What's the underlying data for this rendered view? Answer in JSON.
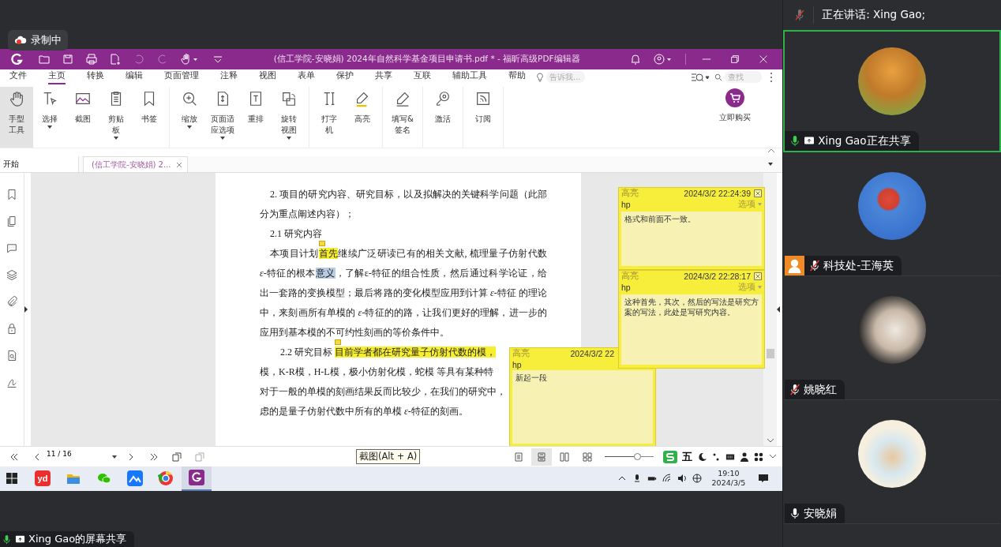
{
  "recording_badge": {
    "label": "录制中"
  },
  "editor": {
    "title": "(信工学院-安晓娟) 2024年自然科学基金项目申请书.pdf * - 福昕高级PDF编辑器",
    "menu_tabs": [
      {
        "label": "文件",
        "selected": false
      },
      {
        "label": "主页",
        "selected": true
      },
      {
        "label": "转换",
        "selected": false
      },
      {
        "label": "编辑",
        "selected": false
      },
      {
        "label": "页面管理",
        "selected": false
      },
      {
        "label": "注释",
        "selected": false
      },
      {
        "label": "视图",
        "selected": false
      },
      {
        "label": "表单",
        "selected": false
      },
      {
        "label": "保护",
        "selected": false
      },
      {
        "label": "共享",
        "selected": false
      },
      {
        "label": "互联",
        "selected": false
      },
      {
        "label": "辅助工具",
        "selected": false
      },
      {
        "label": "帮助",
        "selected": false
      }
    ],
    "tell_me": {
      "placeholder": "告诉我..."
    },
    "find": {
      "placeholder": "查找"
    },
    "ribbon_groups": [
      {
        "items": [
          {
            "label": "手型工具",
            "dropdown": false,
            "selected": true
          },
          {
            "label": "选择",
            "dropdown": true,
            "selected": false
          },
          {
            "label": "截图",
            "dropdown": false,
            "selected": false
          },
          {
            "label": "剪贴板",
            "dropdown": true,
            "selected": false
          },
          {
            "label": "书签",
            "dropdown": false,
            "selected": false
          }
        ]
      },
      {
        "items": [
          {
            "label": "缩放",
            "dropdown": true,
            "selected": false
          },
          {
            "label": "页面适应选项",
            "dropdown": true,
            "selected": false
          },
          {
            "label": "重排",
            "dropdown": false,
            "selected": false
          },
          {
            "label": "旋转视图",
            "dropdown": true,
            "selected": false
          }
        ]
      },
      {
        "items": [
          {
            "label": "打字机",
            "dropdown": false,
            "selected": false
          },
          {
            "label": "高亮",
            "dropdown": false,
            "selected": false
          }
        ]
      },
      {
        "items": [
          {
            "label": "填写&签名",
            "dropdown": false,
            "selected": false
          }
        ]
      },
      {
        "items": [
          {
            "label": "激活",
            "dropdown": false,
            "selected": false
          }
        ]
      },
      {
        "items": [
          {
            "label": "订阅",
            "dropdown": false,
            "selected": false
          }
        ]
      }
    ],
    "buy_button": {
      "label": "立即购买"
    },
    "start_field": {
      "value": "开始"
    },
    "doc_tabs": [
      {
        "label": "(信工学院-安晓娟) 2...",
        "selected": true
      }
    ],
    "paragraphs": [
      {
        "kind": "flow",
        "segments": [
          {
            "kind": "plain",
            "text": "2. 项目的研究内容、研究目标，以及拟解决的关键科学问题（此部分为重点阐述内容）；"
          }
        ]
      },
      {
        "kind": "flow",
        "segments": [
          {
            "kind": "plain",
            "text": "2.1 研究内容"
          }
        ]
      },
      {
        "kind": "flow",
        "segments": [
          {
            "kind": "plain",
            "text": "本项目计划"
          },
          {
            "kind": "highlight",
            "text": "首先"
          },
          {
            "kind": "plain",
            "text": "继续广泛研读已有的相关文献, 梳理量子仿射代数 *ε*-特征的根本"
          },
          {
            "kind": "selection",
            "text": "意义"
          },
          {
            "kind": "plain",
            "text": "，了解ε-特征的组合性质，然后通过科学论证，给出一套路的变换模型；最后将路的变化模型应用到计算 *ε*-特征 的理论中，来刻画所有单模的 *ε*-特征的的路，让我们更好的理解，进一步的应用到基本模的不可约性刻画的等价条件中。"
          }
        ]
      },
      {
        "kind": "lines",
        "lines": [
          [
            {
              "kind": "plain",
              "text": "2.2 研究目标 "
            },
            {
              "kind": "highlight",
              "text": "目前学者都在研究量子仿射代数的模，"
            }
          ],
          [
            {
              "kind": "plain",
              "text": "模，K-R模，H-L模，极小仿射化模，蛇模 等具有某种特"
            }
          ],
          [
            {
              "kind": "plain",
              "text": "对于一般的单模的刻画结果反而比较少，在我们的研究中，"
            }
          ],
          [
            {
              "kind": "plain",
              "text": "虑的是量子仿射代数中所有的单模 *ε*-特征的刻画。"
            }
          ]
        ]
      }
    ],
    "notes": [
      {
        "type_label": "高亮",
        "date": "2024/3/2 22:24:39",
        "closable": true,
        "author": "hp",
        "options": "选项",
        "body": "格式和前面不一致。"
      },
      {
        "type_label": "高亮",
        "date": "2024/3/2 22:28:17",
        "closable": true,
        "author": "hp",
        "options": "选项",
        "body": "这种首先，其次，然后的写法是研究方案的写法，此处是写研究内容。"
      },
      {
        "type_label": "高亮",
        "date": "2024/3/2 22",
        "closable": false,
        "author": "hp",
        "body": "新起一段"
      }
    ],
    "page_field": {
      "value": "11 / 16"
    },
    "tooltip": {
      "label": "截图(Alt + A)"
    },
    "view_modes": [
      {
        "selected": false
      },
      {
        "selected": true
      },
      {
        "selected": false
      },
      {
        "selected": false
      }
    ],
    "zoom_slider": {
      "level": 0.65
    },
    "ime_bar": {
      "label": "五"
    }
  },
  "taskbar": {
    "apps": [
      {
        "label": "yd",
        "active": false
      },
      {
        "active": false
      },
      {
        "active": false
      },
      {
        "active": false
      },
      {
        "active": false
      },
      {
        "active": true
      }
    ],
    "time": "19:10",
    "date": "2024/3/5"
  },
  "screen_share_label": {
    "label": "Xing Gao的屏幕共享"
  },
  "speaking": {
    "label": "正在讲话:  Xing Gao;"
  },
  "participants": [
    {
      "name": "Xing Gao正在共享",
      "muted": false,
      "sharing": true,
      "active_speaker": true,
      "host_badge": false
    },
    {
      "name": "科技处-王海英",
      "muted": true,
      "sharing": false,
      "active_speaker": false,
      "host_badge": true
    },
    {
      "name": "姚晓红",
      "muted": true,
      "sharing": false,
      "active_speaker": false,
      "host_badge": false
    },
    {
      "name": "安晓娟",
      "muted": false,
      "sharing": false,
      "active_speaker": false,
      "host_badge": false
    }
  ]
}
